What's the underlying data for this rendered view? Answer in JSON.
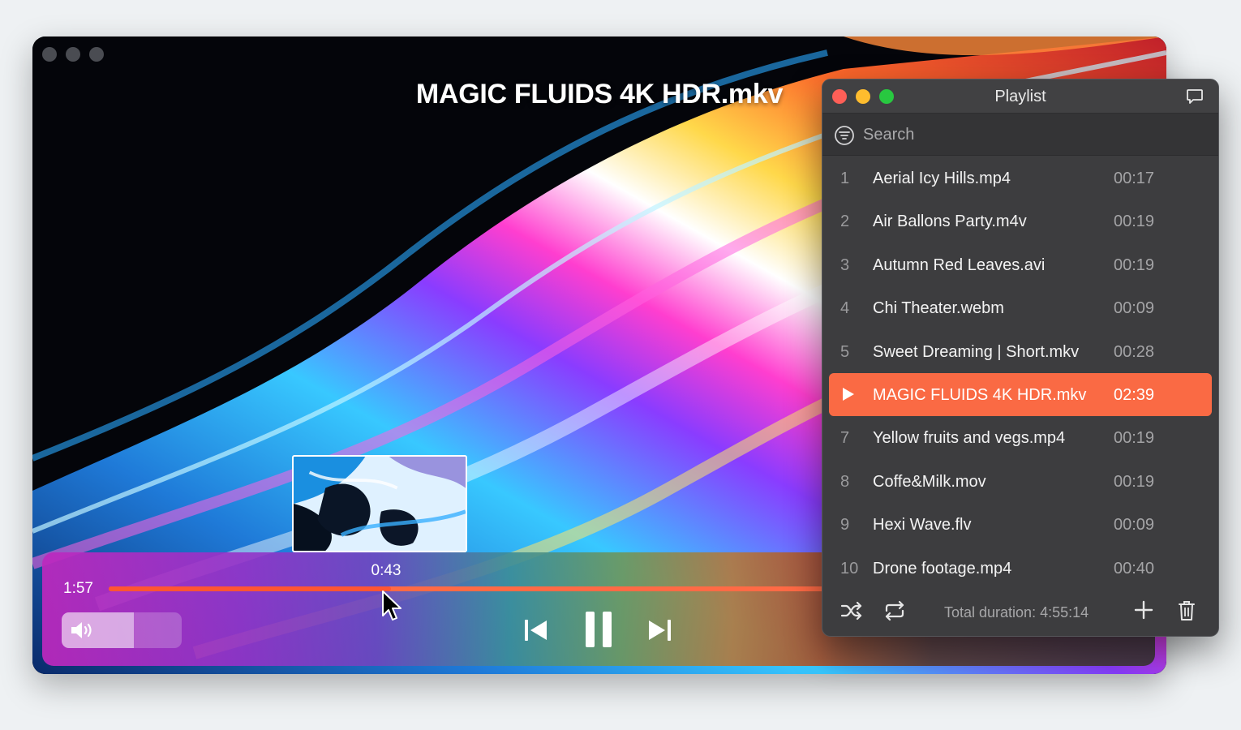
{
  "player": {
    "title": "MAGIC FLUIDS 4K HDR.mkv",
    "hover_time": "0:43",
    "elapsed_time": "1:57",
    "progress": 0.27,
    "volume": 0.6,
    "controls": {
      "previous_icon": "skip-previous-icon",
      "pause_icon": "pause-icon",
      "next_icon": "skip-next-icon",
      "volume_icon": "speaker-volume-icon"
    }
  },
  "playlist": {
    "title": "Playlist",
    "search_placeholder": "Search",
    "items": [
      {
        "num": "1",
        "name": "Aerial Icy Hills.mp4",
        "duration": "00:17",
        "active": false
      },
      {
        "num": "2",
        "name": "Air Ballons Party.m4v",
        "duration": "00:19",
        "active": false
      },
      {
        "num": "3",
        "name": "Autumn Red Leaves.avi",
        "duration": "00:19",
        "active": false
      },
      {
        "num": "4",
        "name": "Chi Theater.webm",
        "duration": "00:09",
        "active": false
      },
      {
        "num": "5",
        "name": "Sweet Dreaming | Short.mkv",
        "duration": "00:28",
        "active": false
      },
      {
        "num": "6",
        "name": "MAGIC FLUIDS 4K HDR.mkv",
        "duration": "02:39",
        "active": true
      },
      {
        "num": "7",
        "name": "Yellow fruits and vegs.mp4",
        "duration": "00:19",
        "active": false
      },
      {
        "num": "8",
        "name": "Coffe&Milk.mov",
        "duration": "00:19",
        "active": false
      },
      {
        "num": "9",
        "name": "Hexi Wave.flv",
        "duration": "00:09",
        "active": false
      },
      {
        "num": "10",
        "name": "Drone footage.mp4",
        "duration": "00:40",
        "active": false
      }
    ],
    "total_duration": "Total duration: 4:55:14",
    "footer_icons": [
      "shuffle-icon",
      "repeat-icon",
      "add-icon",
      "trash-icon"
    ]
  },
  "colors": {
    "accent": "#fa6a44",
    "seek": "#ff5533",
    "panel": "#3d3d3f"
  }
}
